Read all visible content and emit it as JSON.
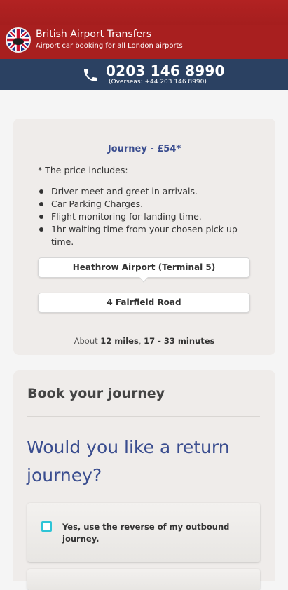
{
  "header": {
    "brand_title": "British Airport Transfers",
    "brand_subtitle": "Airport car booking for all London airports",
    "logo_icon": "union-jack-taxi-logo",
    "brand_color": "#a81f1f"
  },
  "contact": {
    "phone_icon": "phone-icon",
    "phone": "0203 146 8990",
    "overseas": "(Overseas: +44 203 146 8990)",
    "bar_color": "#2b4162"
  },
  "journey": {
    "title": "Journey - £54*",
    "price_note": "* The price includes:",
    "includes": [
      "Driver meet and greet in arrivals.",
      "Car Parking Charges.",
      "Flight monitoring for landing time.",
      "1hr waiting time from your chosen pick up time."
    ],
    "from": "Heathrow Airport (Terminal 5)",
    "to": "4 Fairfield Road",
    "distance_prefix": "About ",
    "distance_miles": "12 miles",
    "distance_sep": ", ",
    "distance_time": "17 - 33 minutes",
    "accent_color": "#3a4d8f"
  },
  "booking": {
    "title": "Book your journey",
    "return_question": "Would you like a return journey?",
    "options": [
      {
        "label": "Yes, use the reverse of my outbound journey.",
        "checked": false
      }
    ],
    "checkbox_color": "#2ec4d6"
  }
}
